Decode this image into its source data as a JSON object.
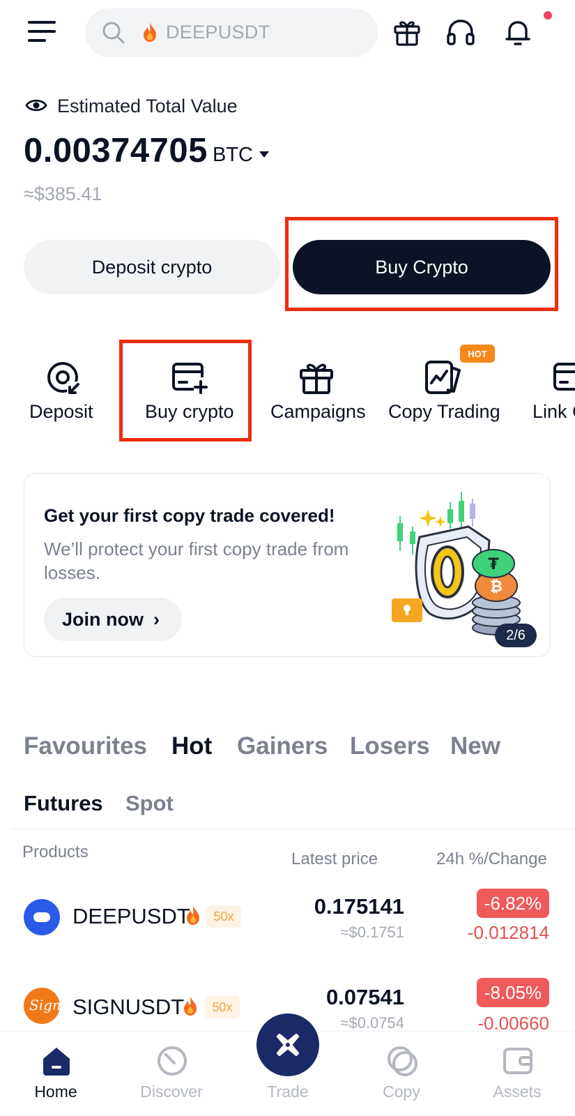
{
  "search": {
    "placeholder": "DEEPUSDT"
  },
  "balance": {
    "label": "Estimated Total Value",
    "amount": "0.00374705",
    "unit": "BTC",
    "approx_usd": "≈$385.41"
  },
  "actions": {
    "deposit_label": "Deposit crypto",
    "buy_label": "Buy Crypto"
  },
  "shortcuts": [
    {
      "label": "Deposit",
      "icon": "deposit-icon"
    },
    {
      "label": "Buy crypto",
      "icon": "card-plus-icon"
    },
    {
      "label": "Campaigns",
      "icon": "gift-icon"
    },
    {
      "label": "Copy Trading",
      "icon": "copy-trading-icon",
      "badge": "HOT"
    },
    {
      "label": "Link C",
      "icon": "link-card-icon"
    }
  ],
  "promo": {
    "title": "Get your first copy trade covered!",
    "description": "We’ll protect your first copy trade from losses.",
    "button": "Join now",
    "pager": "2/6"
  },
  "market_tabs": [
    "Favourites",
    "Hot",
    "Gainers",
    "Losers",
    "New"
  ],
  "market_tab_active": "Hot",
  "sub_tabs": [
    "Futures",
    "Spot"
  ],
  "sub_tab_active": "Futures",
  "columns": {
    "products": "Products",
    "latest_price": "Latest price",
    "change": "24h %/Change"
  },
  "rows": [
    {
      "symbol": "DEEPUSDT",
      "leverage": "50x",
      "price": "0.175141",
      "price_usd": "≈$0.1751",
      "change_pct": "-6.82%",
      "change_abs": "-0.012814",
      "icon_color": "#2b5ae8"
    },
    {
      "symbol": "SIGNUSDT",
      "leverage": "50x",
      "price": "0.07541",
      "price_usd": "≈$0.0754",
      "change_pct": "-8.05%",
      "change_abs": "-0.00660",
      "icon_color": "#f07a1a"
    }
  ],
  "nav": [
    {
      "label": "Home",
      "icon": "home-icon",
      "active": true
    },
    {
      "label": "Discover",
      "icon": "discover-icon"
    },
    {
      "label": "Trade",
      "icon": "trade-icon"
    },
    {
      "label": "Copy",
      "icon": "copy-icon"
    },
    {
      "label": "Assets",
      "icon": "wallet-icon"
    }
  ],
  "colors": {
    "primary_dark": "#0b1324",
    "highlight_red": "#ee2c10",
    "negative": "#ef5a5a",
    "hot_badge": "#f7881b",
    "trade_button": "#1a2a66"
  }
}
